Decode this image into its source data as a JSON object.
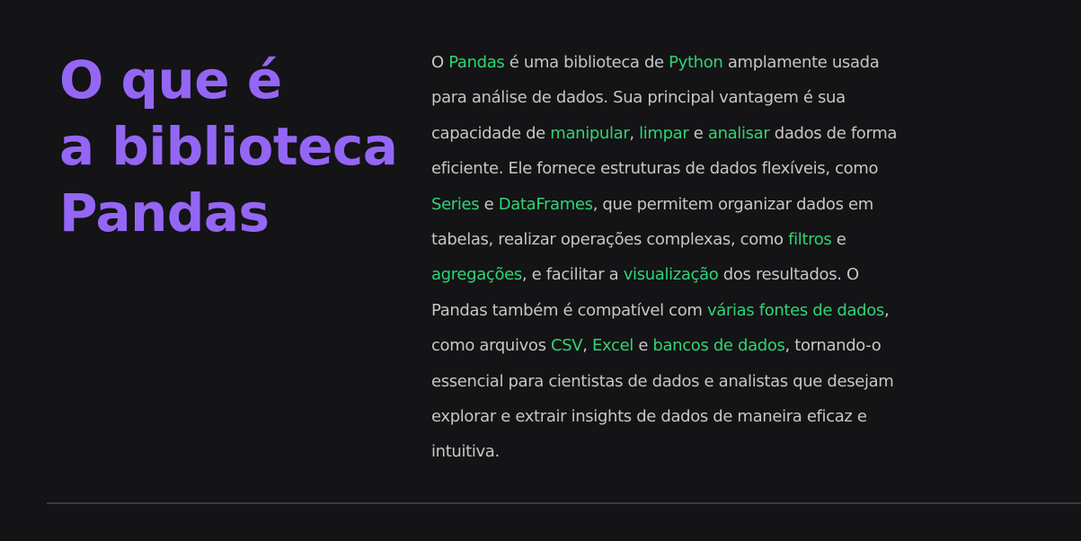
{
  "heading": {
    "lines": [
      "O que é",
      "a biblioteca",
      "Pandas"
    ]
  },
  "description": {
    "lines": [
      [
        {
          "t": "O "
        },
        {
          "t": "Pandas",
          "hl": true
        },
        {
          "t": " é uma biblioteca de "
        },
        {
          "t": "Python",
          "hl": true
        },
        {
          "t": " amplamente usada"
        }
      ],
      [
        {
          "t": "para análise de dados. Sua principal vantagem é sua"
        }
      ],
      [
        {
          "t": "capacidade de "
        },
        {
          "t": "manipular",
          "hl": true
        },
        {
          "t": ", "
        },
        {
          "t": "limpar",
          "hl": true
        },
        {
          "t": " e "
        },
        {
          "t": "analisar",
          "hl": true
        },
        {
          "t": " dados de forma"
        }
      ],
      [
        {
          "t": "eficiente. Ele fornece estruturas de dados flexíveis, como"
        }
      ],
      [
        {
          "t": "Series",
          "hl": true
        },
        {
          "t": " e "
        },
        {
          "t": "DataFrames",
          "hl": true
        },
        {
          "t": ", que permitem organizar dados em"
        }
      ],
      [
        {
          "t": "tabelas, realizar operações complexas, como "
        },
        {
          "t": "filtros",
          "hl": true
        },
        {
          "t": " e"
        }
      ],
      [
        {
          "t": "agregações",
          "hl": true
        },
        {
          "t": ", e facilitar a "
        },
        {
          "t": "visualização",
          "hl": true
        },
        {
          "t": " dos resultados. O"
        }
      ],
      [
        {
          "t": "Pandas também é compatível com "
        },
        {
          "t": "várias fontes de dados",
          "hl": true
        },
        {
          "t": ","
        }
      ],
      [
        {
          "t": "como arquivos "
        },
        {
          "t": "CSV",
          "hl": true
        },
        {
          "t": ", "
        },
        {
          "t": "Excel",
          "hl": true
        },
        {
          "t": " e "
        },
        {
          "t": "bancos de dados",
          "hl": true
        },
        {
          "t": ", tornando-o"
        }
      ],
      [
        {
          "t": "essencial para cientistas de dados e analistas que desejam"
        }
      ],
      [
        {
          "t": "explorar e extrair insights de dados de maneira eficaz e"
        }
      ],
      [
        {
          "t": "intuitiva."
        }
      ]
    ]
  },
  "colors": {
    "background": "#141316",
    "heading": "#9466f5",
    "body_text": "#c6c6c6",
    "highlight": "#2ed573",
    "divider": "#3a393d"
  }
}
